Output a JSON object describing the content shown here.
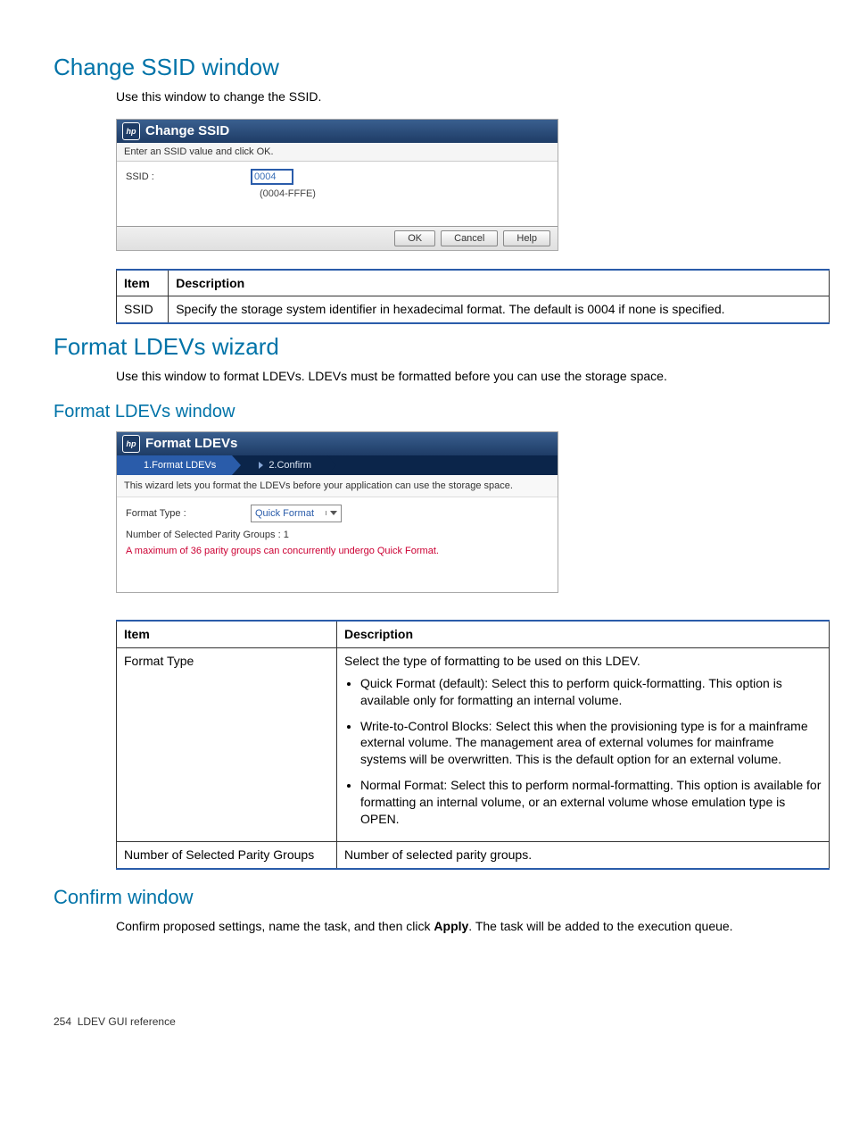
{
  "sections": {
    "changeSsid": {
      "title": "Change SSID window",
      "intro": "Use this window to change the SSID."
    },
    "formatWizard": {
      "title": "Format LDEVs wizard",
      "intro": "Use this window to format LDEVs. LDEVs must be formatted before you can use the storage space."
    },
    "formatWindow": {
      "title": "Format LDEVs window"
    },
    "confirmWindow": {
      "title": "Confirm window",
      "intro_pre": "Confirm proposed settings, name the task, and then click ",
      "intro_bold": "Apply",
      "intro_post": ". The task will be added to the execution queue."
    }
  },
  "changeSsidDialog": {
    "title": "Change SSID",
    "subtitle": "Enter an SSID value and click OK.",
    "fieldLabel": "SSID :",
    "value": "0004",
    "hint": "(0004-FFFE)",
    "buttons": {
      "ok": "OK",
      "cancel": "Cancel",
      "help": "Help"
    }
  },
  "ssidTable": {
    "headers": {
      "item": "Item",
      "desc": "Description"
    },
    "row": {
      "item": "SSID",
      "desc": "Specify the storage system identifier in hexadecimal format. The default is 0004 if none is specified."
    }
  },
  "formatDialog": {
    "title": "Format LDEVs",
    "steps": {
      "s1": "1.Format LDEVs",
      "s2": "2.Confirm"
    },
    "instruction": "This wizard lets you format the LDEVs before your application can use the storage space.",
    "formatTypeLabel": "Format Type :",
    "formatTypeValue": "Quick Format",
    "parityLabel": "Number of Selected Parity Groups : 1",
    "warning": "A maximum of 36 parity groups can concurrently undergo Quick Format."
  },
  "formatTable": {
    "headers": {
      "item": "Item",
      "desc": "Description"
    },
    "row1": {
      "item": "Format Type",
      "desc_lead": "Select the type of formatting to be used on this LDEV.",
      "b1": "Quick Format (default): Select this to perform quick-formatting. This option is available only for formatting an internal volume.",
      "b2": "Write-to-Control Blocks: Select this when the provisioning type is for a mainframe external volume. The management area of external volumes for mainframe systems will be overwritten. This is the default option for an external volume.",
      "b3": "Normal Format: Select this to perform normal-formatting. This option is available for formatting an internal volume, or an external volume whose emulation type is OPEN."
    },
    "row2": {
      "item": "Number of Selected Parity Groups",
      "desc": "Number of selected parity groups."
    }
  },
  "footer": {
    "pageNum": "254",
    "pageTitle": "LDEV GUI reference"
  }
}
